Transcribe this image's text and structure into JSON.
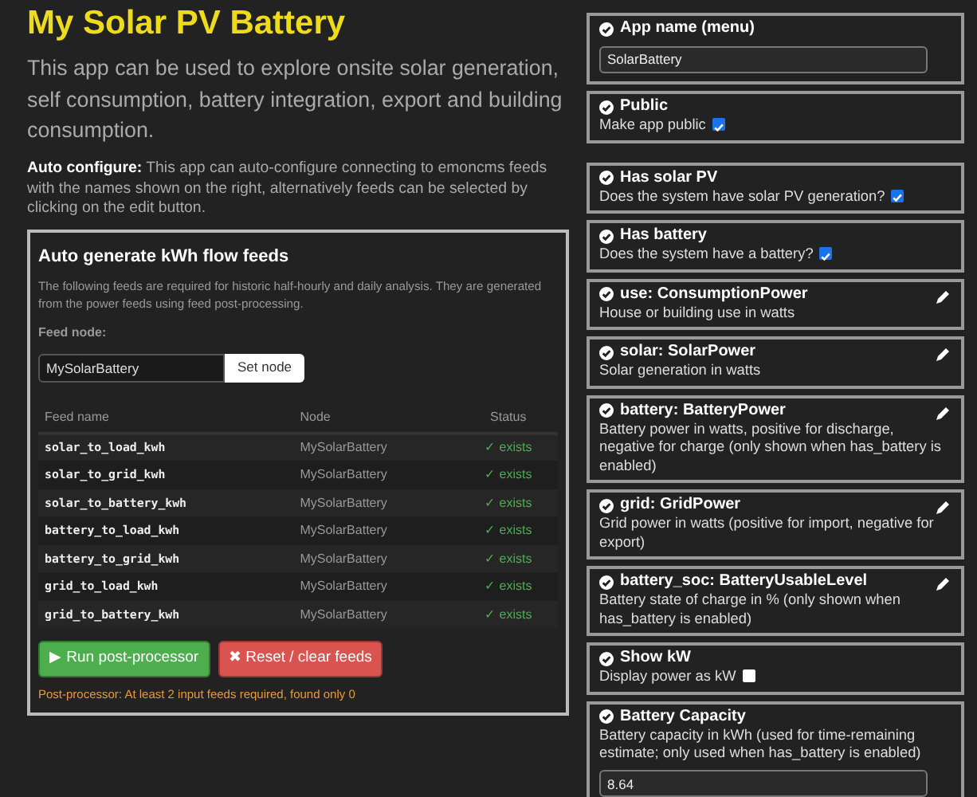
{
  "title": "My Solar PV Battery",
  "description": "This app can be used to explore onsite solar generation, self consumption, battery integration, export and building consumption.",
  "auto_configure": "**Auto configure:** This app can auto-configure connecting to emoncms feeds with the names shown on the right, alternatively feeds can be selected by clicking on the edit button.",
  "feeds_panel": {
    "title": "Auto generate kWh flow feeds",
    "description": "The following feeds are required for historic half-hourly and daily analysis. They are generated from the power feeds using feed post-processing.",
    "feed_node_label": "Feed node:",
    "feed_node_value": "MySolarBattery",
    "set_node_button": "Set node",
    "columns": [
      "Feed name",
      "Node",
      "Status"
    ],
    "rows": [
      {
        "name": "solar_to_load_kwh",
        "node": "MySolarBattery",
        "status": "✓ exists"
      },
      {
        "name": "solar_to_grid_kwh",
        "node": "MySolarBattery",
        "status": "✓ exists"
      },
      {
        "name": "solar_to_battery_kwh",
        "node": "MySolarBattery",
        "status": "✓ exists"
      },
      {
        "name": "battery_to_load_kwh",
        "node": "MySolarBattery",
        "status": "✓ exists"
      },
      {
        "name": "battery_to_grid_kwh",
        "node": "MySolarBattery",
        "status": "✓ exists"
      },
      {
        "name": "grid_to_load_kwh",
        "node": "MySolarBattery",
        "status": "✓ exists"
      },
      {
        "name": "grid_to_battery_kwh",
        "node": "MySolarBattery",
        "status": "✓ exists"
      }
    ],
    "buttons": [
      {
        "label": "▶ Run post-processor",
        "kind": "success"
      },
      {
        "label": "✖ Reset / clear feeds",
        "kind": "danger"
      }
    ],
    "message": "Post-processor: At least 2 input feeds required, found only 0"
  },
  "settings": [
    {
      "items": [
        {
          "kind": "text",
          "title": "App name (menu)",
          "value": "SolarBattery"
        },
        {
          "kind": "checkbox",
          "title": "Public",
          "description": "Make app public",
          "checked": true
        }
      ]
    },
    {
      "items": [
        {
          "kind": "checkbox",
          "title": "Has solar PV",
          "description": "Does the system have solar PV generation?",
          "checked": true
        },
        {
          "kind": "checkbox",
          "title": "Has battery",
          "description": "Does the system have a battery?",
          "checked": true
        },
        {
          "kind": "feed",
          "title": "use: ConsumptionPower",
          "description": "House or building use in watts"
        },
        {
          "kind": "feed",
          "title": "solar: SolarPower",
          "description": "Solar generation in watts"
        },
        {
          "kind": "feed",
          "title": "battery: BatteryPower",
          "description": "Battery power in watts, positive for discharge, negative for charge (only shown when has_battery is enabled)"
        },
        {
          "kind": "feed",
          "title": "grid: GridPower",
          "description": "Grid power in watts (positive for import, negative for export)"
        },
        {
          "kind": "feed",
          "title": "battery_soc: BatteryUsableLevel",
          "description": "Battery state of charge in % (only shown when has_battery is enabled)"
        },
        {
          "kind": "checkbox",
          "title": "Show kW",
          "description": "Display power as kW",
          "checked": false
        },
        {
          "kind": "text",
          "title": "Battery Capacity",
          "description": "Battery capacity in kWh (used for time-remaining estimate; only used when has_battery is enabled)",
          "value": "8.64"
        }
      ]
    }
  ]
}
